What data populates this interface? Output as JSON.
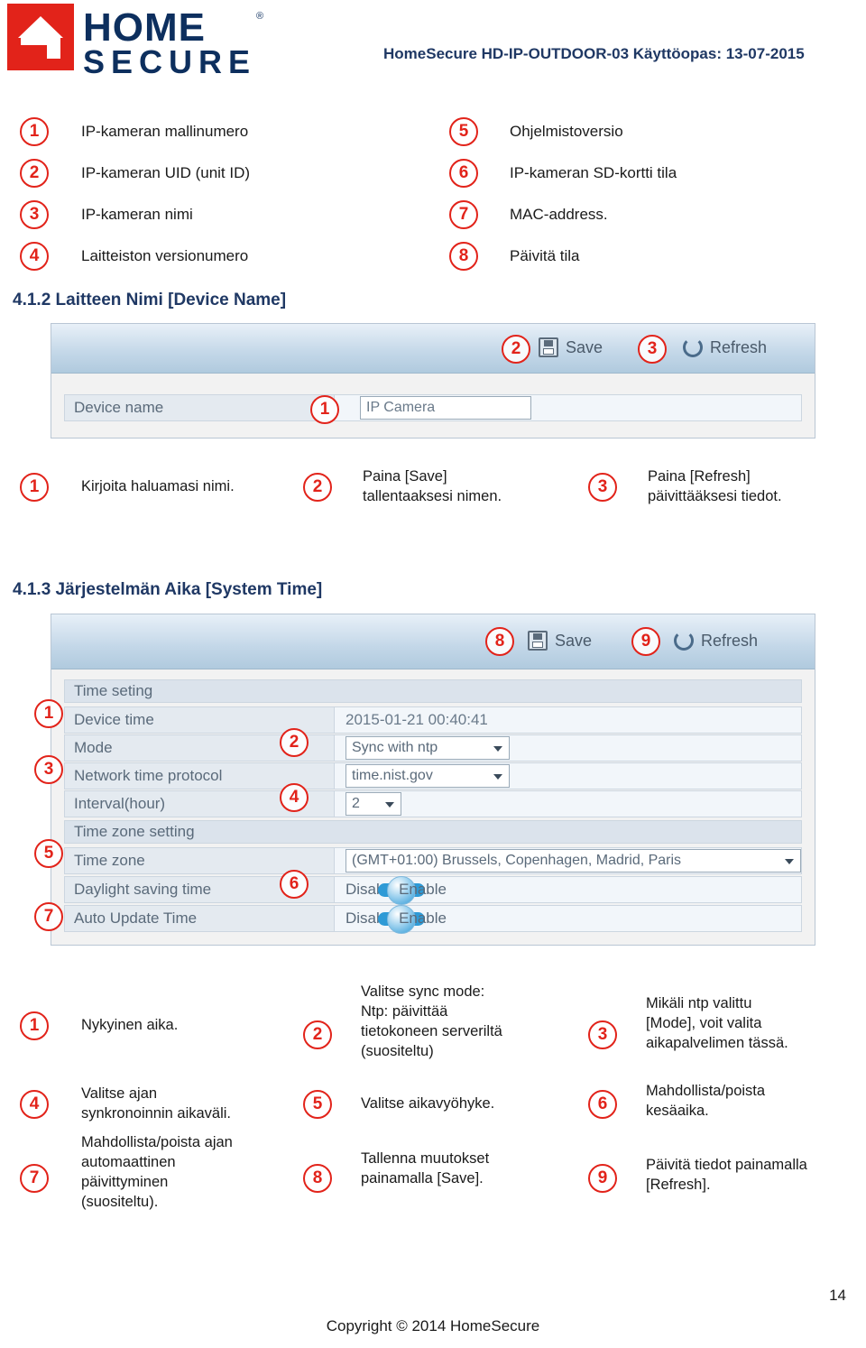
{
  "header": {
    "logo_home": "HOME",
    "logo_secure": "SECURE",
    "logo_reg": "®",
    "doc_title": "HomeSecure HD-IP-OUTDOOR-03 Käyttöopas: 13-07-2015"
  },
  "legend": {
    "left": [
      {
        "num": "1",
        "text": "IP-kameran mallinumero"
      },
      {
        "num": "2",
        "text": "IP-kameran UID (unit ID)"
      },
      {
        "num": "3",
        "text": "IP-kameran nimi"
      },
      {
        "num": "4",
        "text": "Laitteiston versionumero"
      }
    ],
    "right": [
      {
        "num": "5",
        "text": "Ohjelmistoversio"
      },
      {
        "num": "6",
        "text": "IP-kameran SD-kortti tila"
      },
      {
        "num": "7",
        "text": "MAC-address."
      },
      {
        "num": "8",
        "text": "Päivitä tila"
      }
    ]
  },
  "section_device_name": {
    "heading": "4.1.2 Laitteen Nimi [Device Name]",
    "screenshot": {
      "save_badge": "2",
      "save_label": "Save",
      "refresh_badge": "3",
      "refresh_label": "Refresh",
      "field_label": "Device name",
      "field_badge": "1",
      "field_value": "IP Camera"
    },
    "explanations": [
      {
        "num": "1",
        "text": "Kirjoita haluamasi nimi."
      },
      {
        "num": "2",
        "text": "Paina [Save]\ntallentaaksesi nimen."
      },
      {
        "num": "3",
        "text": "Paina [Refresh]\npäivittääksesi tiedot."
      }
    ]
  },
  "section_system_time": {
    "heading": "4.1.3 Järjestelmän Aika [System Time]",
    "screenshot": {
      "save_badge": "8",
      "save_label": "Save",
      "refresh_badge": "9",
      "refresh_label": "Refresh",
      "group_time": "Time seting",
      "group_zone": "Time zone setting",
      "rows": [
        {
          "badge": "1",
          "label": "Device time",
          "value": "2015-01-21 00:40:41"
        },
        {
          "badge": "2",
          "label": "Mode",
          "value": "Sync with ntp"
        },
        {
          "badge": "3",
          "label": "Network time protocol",
          "value": "time.nist.gov"
        },
        {
          "badge": "4",
          "label": "Interval(hour)",
          "value": "2"
        },
        {
          "badge": "5",
          "label": "Time zone",
          "value": "(GMT+01:00) Brussels, Copenhagen, Madrid, Paris"
        },
        {
          "badge": "6",
          "label": "Daylight saving time",
          "value_off": "Disable",
          "value_on": "Enable"
        },
        {
          "badge": "7",
          "label": "Auto Update Time",
          "value_off": "Disable",
          "value_on": "Enable"
        }
      ]
    },
    "explanations": [
      {
        "num": "1",
        "text": "Nykyinen aika."
      },
      {
        "num": "2",
        "text": "Valitse sync mode:\nNtp: päivittää\ntietokoneen serveriltä\n(suositeltu)"
      },
      {
        "num": "3",
        "text": "Mikäli ntp valittu\n[Mode], voit valita\naikapalvelimen tässä."
      },
      {
        "num": "4",
        "text": "Valitse ajan\nsynkronoinnin aikaväli."
      },
      {
        "num": "5",
        "text": "Valitse aikavyöhyke."
      },
      {
        "num": "6",
        "text": "Mahdollista/poista\nkesäaika."
      },
      {
        "num": "7",
        "text": "Mahdollista/poista ajan\nautomaattinen\npäivittyminen\n(suositeltu)."
      },
      {
        "num": "8",
        "text": "Tallenna muutokset\npainamalla [Save]."
      },
      {
        "num": "9",
        "text": "Päivitä tiedot painamalla\n[Refresh]."
      }
    ]
  },
  "footer": {
    "copyright": "Copyright © 2014 HomeSecure",
    "page_number": "14"
  },
  "colors": {
    "brand_red": "#e2231a",
    "brand_navy": "#0d2f5e",
    "heading_blue": "#1f3864"
  }
}
